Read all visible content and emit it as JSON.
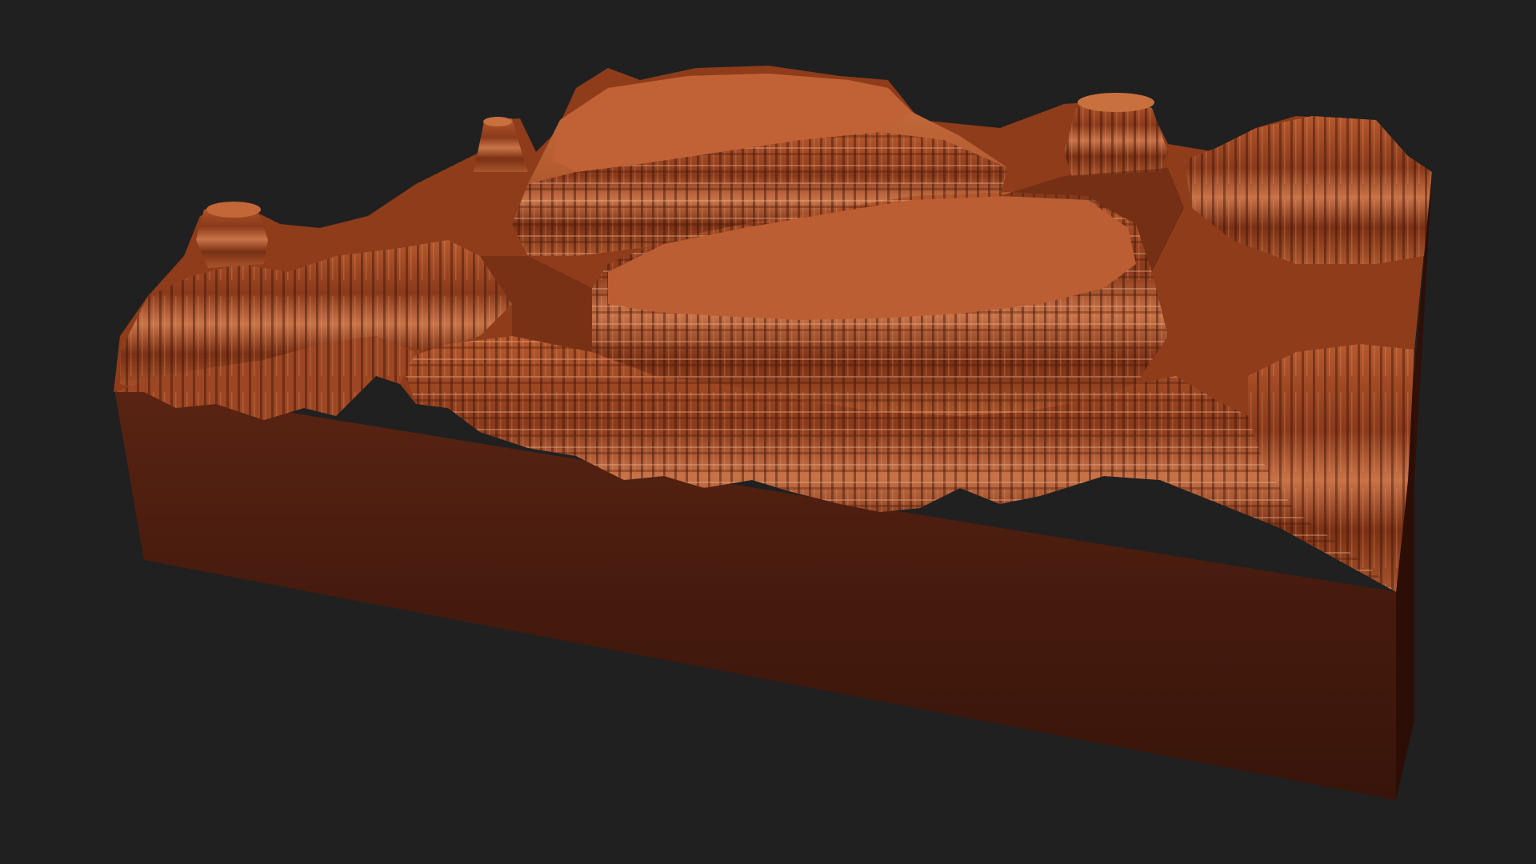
{
  "scene": {
    "subject": "terrain-block",
    "colors": {
      "background": "#202020",
      "base_front": "#4a1c10",
      "base_front_dark": "#351208",
      "base_right": "#2e0f07",
      "surface_light": "#c96a3c",
      "surface_mid": "#a24a24",
      "surface_dark": "#5e2410",
      "strata_highlight": "#e8a77f",
      "crevice": "#3a1408"
    }
  }
}
